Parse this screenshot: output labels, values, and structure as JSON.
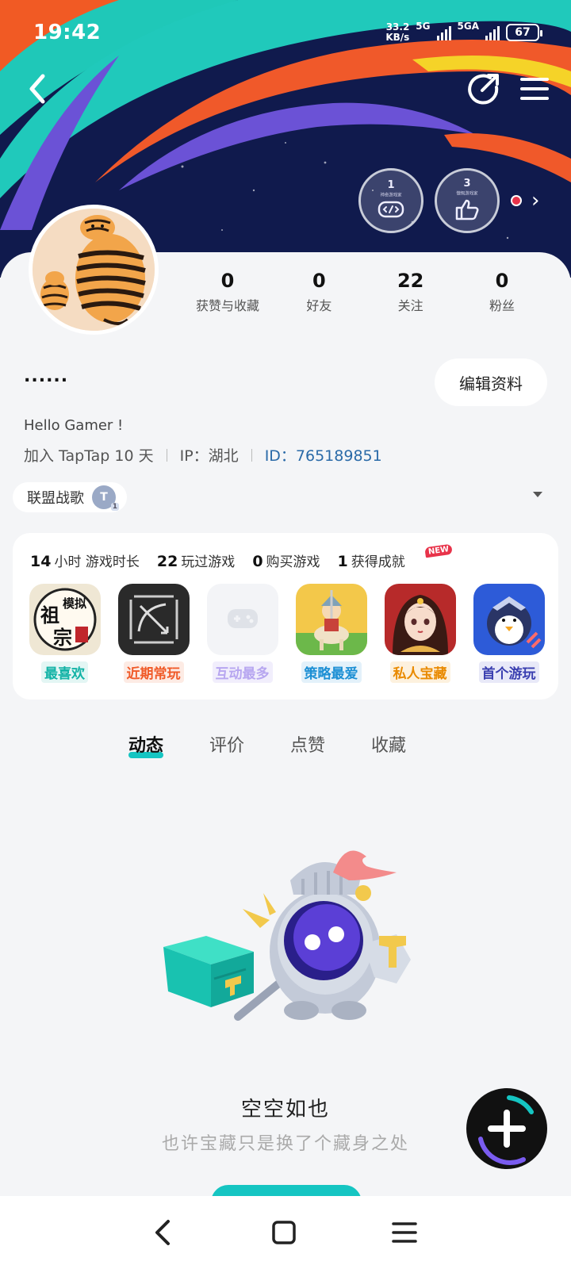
{
  "status": {
    "time": "19:42",
    "net_speed_value": "33.2",
    "net_speed_unit": "KB/s",
    "sig1_label": "5G",
    "sig2_label": "5GA",
    "battery": "67"
  },
  "badges": [
    {
      "level": "1",
      "name": "神奇游戏家",
      "icon": "controller-icon"
    },
    {
      "level": "3",
      "name": "慷慨游戏家",
      "icon": "thumbs-up-icon"
    }
  ],
  "stats": [
    {
      "value": "0",
      "label": "获赞与收藏"
    },
    {
      "value": "0",
      "label": "好友"
    },
    {
      "value": "22",
      "label": "关注"
    },
    {
      "value": "0",
      "label": "粉丝"
    }
  ],
  "profile": {
    "username": "......",
    "edit_label": "编辑资料",
    "bio": "Hello Gamer !",
    "joined": "加入 TapTap 10 天",
    "ip": "IP：湖北",
    "id": "ID：765189851",
    "guild_name": "联盟战歌",
    "guild_icon_letter": "T",
    "guild_icon_sub": "1"
  },
  "game_stats": [
    {
      "value": "14",
      "label": "小时 游戏时长"
    },
    {
      "value": "22",
      "label": "玩过游戏"
    },
    {
      "value": "0",
      "label": "购买游戏"
    },
    {
      "value": "1",
      "label": "获得成就"
    }
  ],
  "new_badge": "NEW",
  "games": [
    {
      "tag": "最喜欢",
      "color": "#13b3a6",
      "bg": "#e3f6f4",
      "icon": "zuzong-moni-icon",
      "icon_text": "祖",
      "icon_text2": "模拟",
      "icon_text3": "宗"
    },
    {
      "tag": "近期常玩",
      "color": "#f05a28",
      "bg": "#fdebe4",
      "icon": "bow-arrow-icon"
    },
    {
      "tag": "互动最多",
      "color": "#b7a6f0",
      "bg": "#f1eefc",
      "icon": "gamepad-placeholder-icon"
    },
    {
      "tag": "策略最爱",
      "color": "#1c8fd4",
      "bg": "#e3f1fa",
      "icon": "knight-horse-icon"
    },
    {
      "tag": "私人宝藏",
      "color": "#e98a00",
      "bg": "#fdf1de",
      "icon": "anime-girl-icon"
    },
    {
      "tag": "首个游玩",
      "color": "#3a3fb0",
      "bg": "#e8e9f8",
      "icon": "penguin-hero-icon"
    }
  ],
  "tabs": [
    {
      "label": "动态",
      "active": true
    },
    {
      "label": "评价",
      "active": false
    },
    {
      "label": "点赞",
      "active": false
    },
    {
      "label": "收藏",
      "active": false
    }
  ],
  "empty": {
    "title": "空空如也",
    "subtitle": "也许宝藏只是换了个藏身之处"
  },
  "colors": {
    "accent": "#15c5c2",
    "id_link": "#2a6aa8"
  }
}
